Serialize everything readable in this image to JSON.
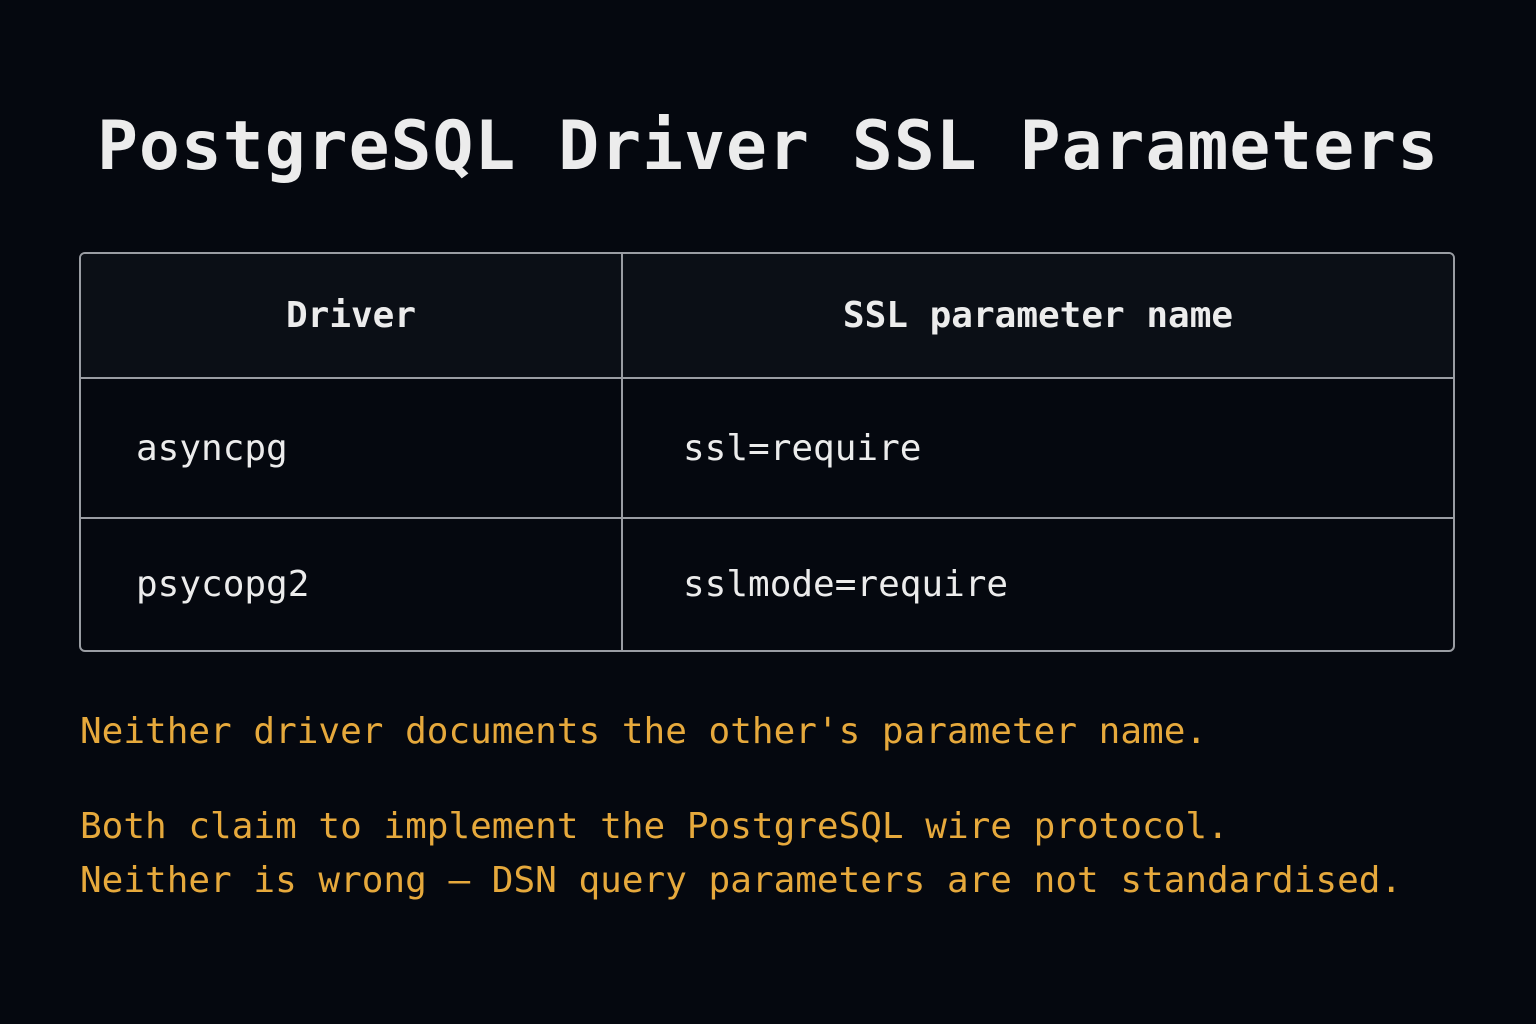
{
  "title": "PostgreSQL Driver SSL Parameters",
  "table": {
    "headers": [
      "Driver",
      "SSL parameter name"
    ],
    "rows": [
      [
        "asyncpg",
        "ssl=require"
      ],
      [
        "psycopg2",
        "sslmode=require"
      ]
    ]
  },
  "notes": [
    "Neither driver documents the other's parameter name.",
    "Both claim to implement the PostgreSQL wire protocol.",
    "Neither is wrong — DSN query parameters are not standardised."
  ],
  "colors": {
    "background": "#05080f",
    "text": "#ececec",
    "accent": "#e6a93c",
    "border": "#9a9da3"
  }
}
